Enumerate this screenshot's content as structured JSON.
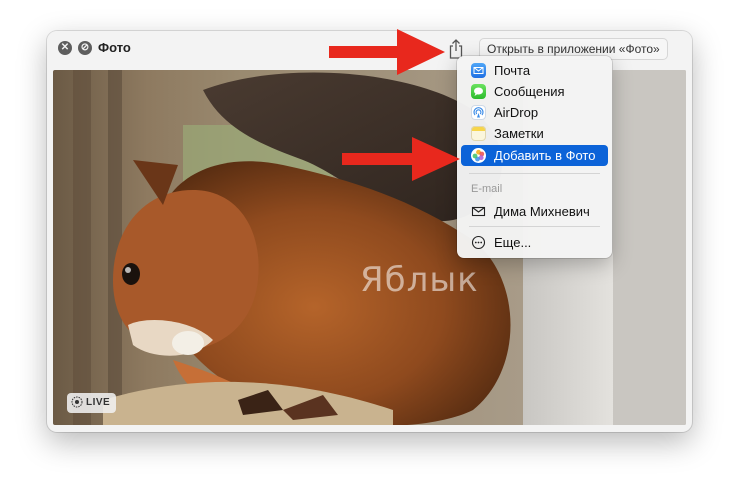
{
  "window": {
    "title": "Фото",
    "open_button_label": "Открыть в приложении «Фото»",
    "live_badge": "LIVE",
    "watermark": "Яблык"
  },
  "share_menu": {
    "items": [
      {
        "label": "Почта",
        "icon": "mail-icon"
      },
      {
        "label": "Сообщения",
        "icon": "messages-icon"
      },
      {
        "label": "AirDrop",
        "icon": "airdrop-icon"
      },
      {
        "label": "Заметки",
        "icon": "notes-icon"
      },
      {
        "label": "Добавить в Фото",
        "icon": "photos-icon",
        "selected": true
      }
    ],
    "section_label": "E-mail",
    "contact": {
      "label": "Дима Михневич",
      "icon": "envelope-icon"
    },
    "more": {
      "label": "Еще...",
      "icon": "more-icon"
    }
  },
  "colors": {
    "selection": "#0c63d8",
    "arrow": "#e8281d"
  }
}
